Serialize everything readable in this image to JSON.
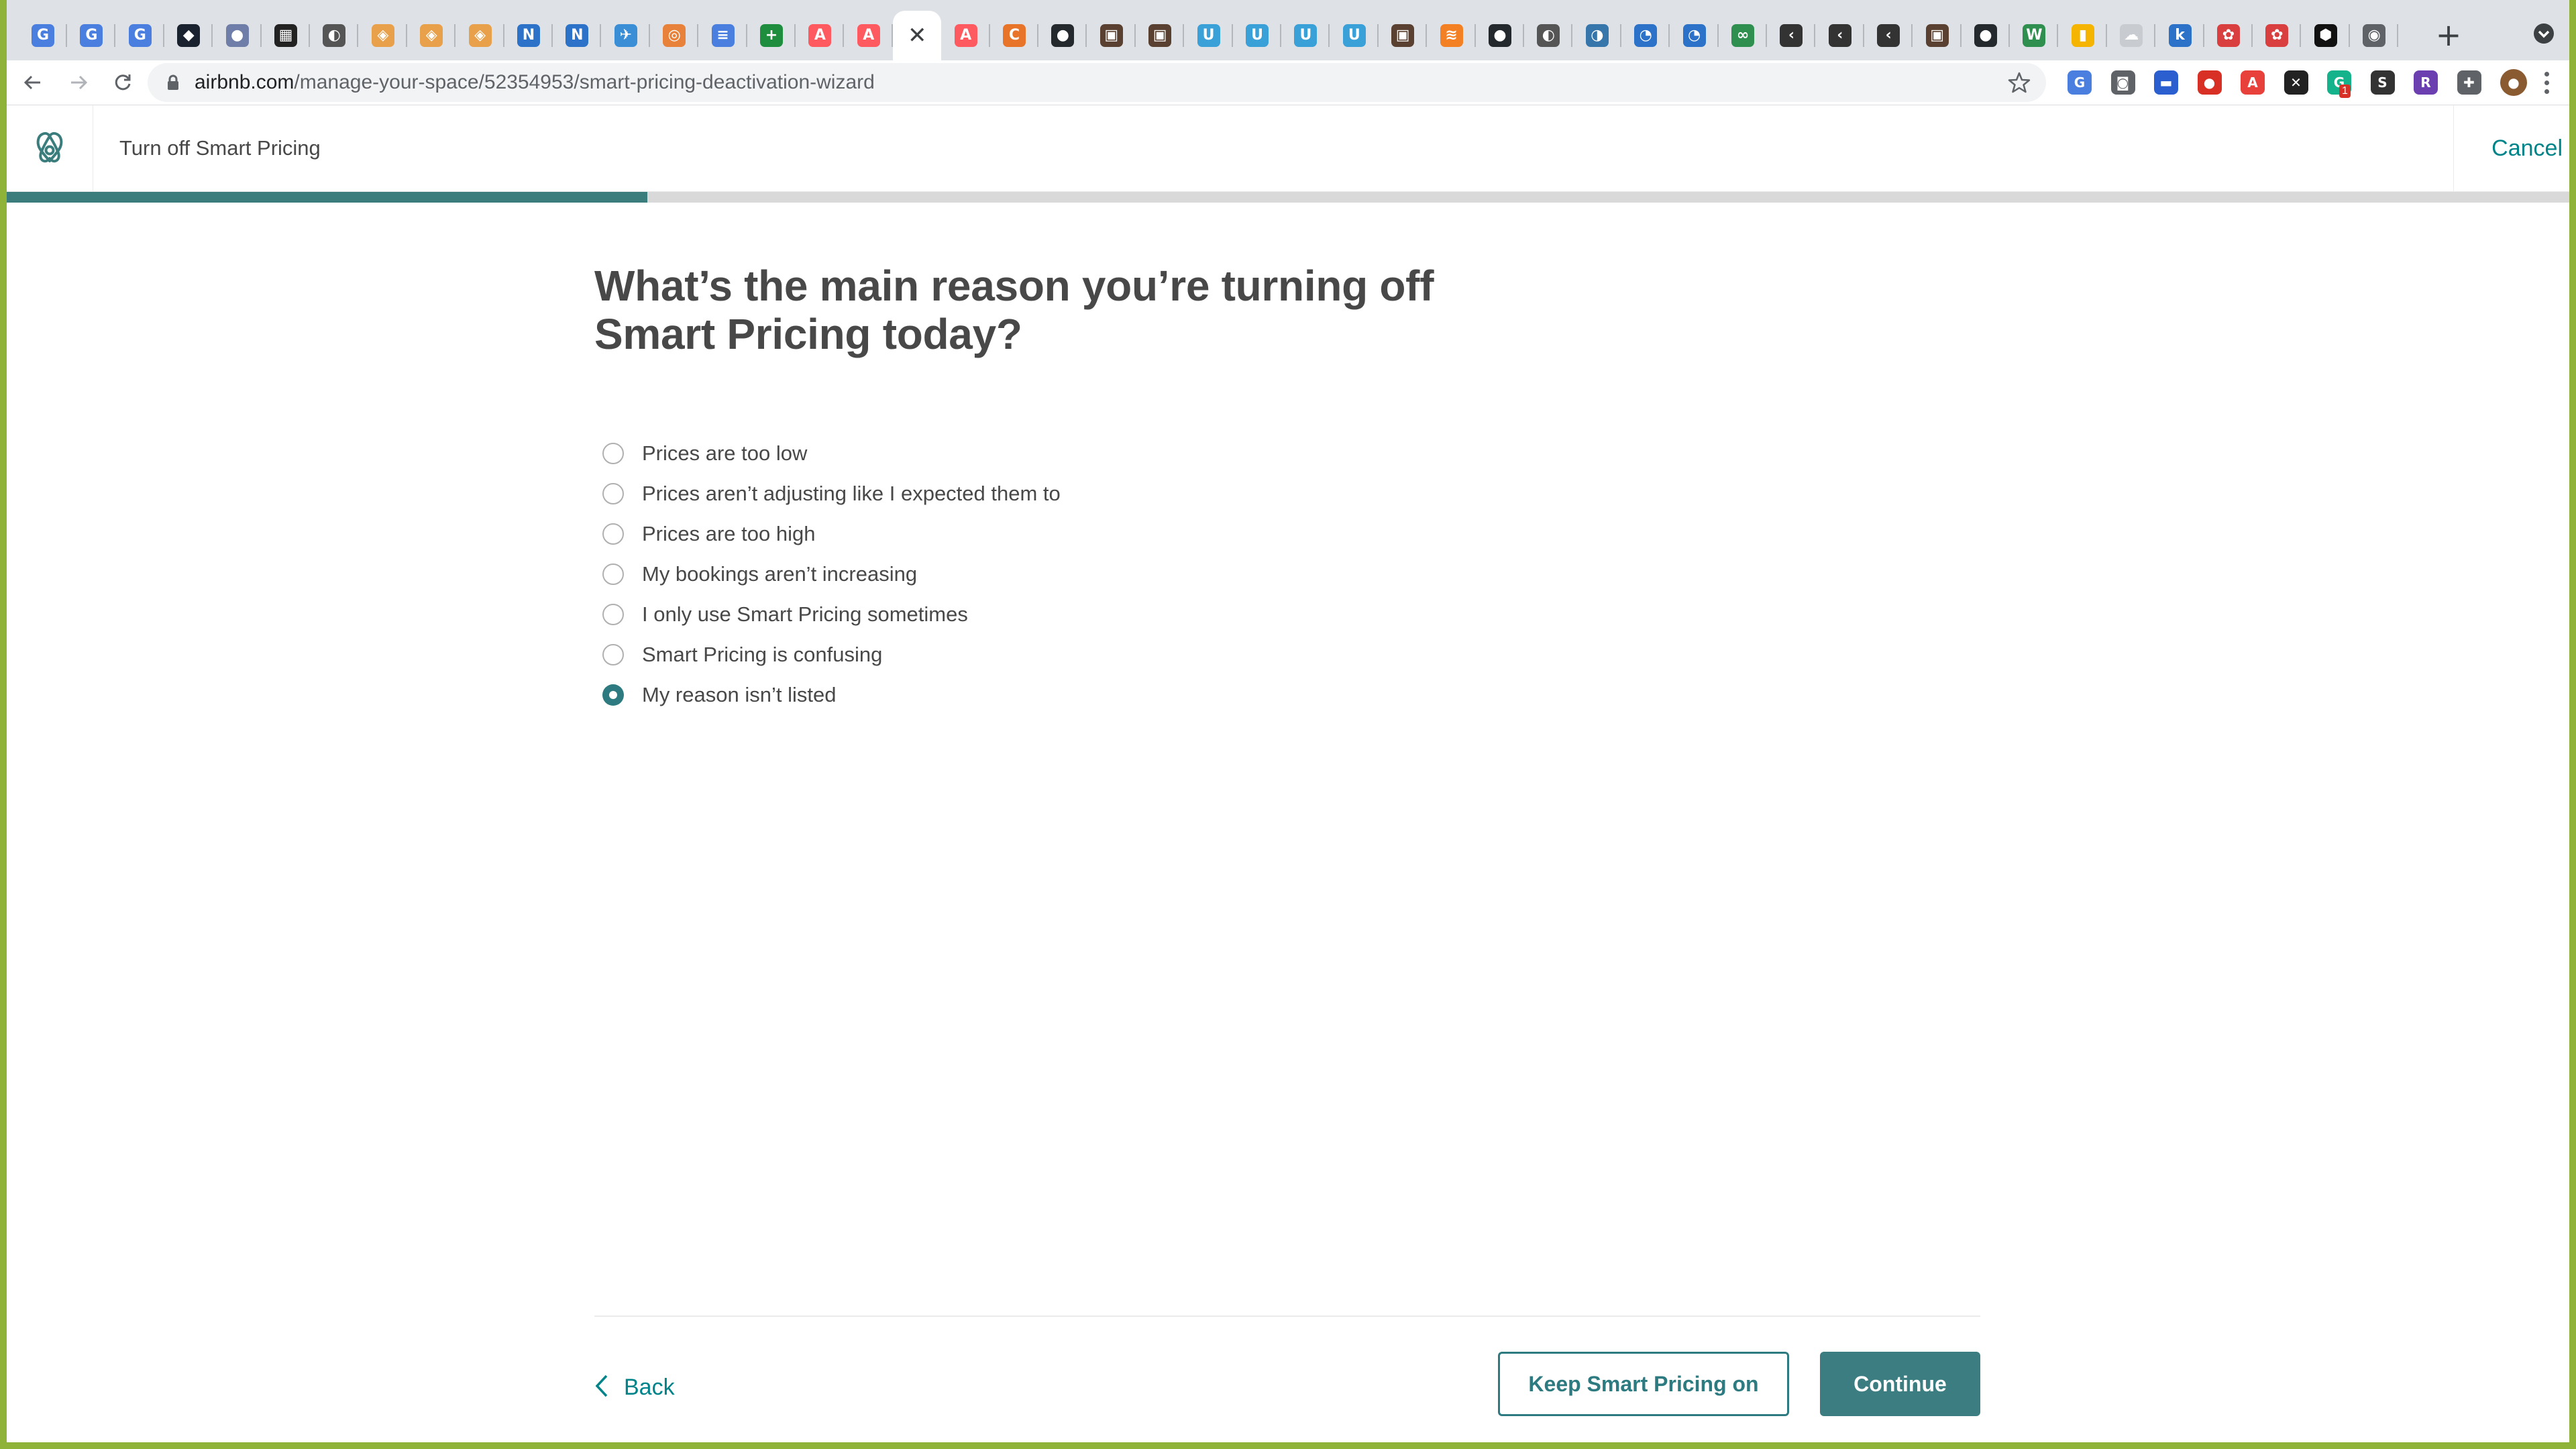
{
  "browser": {
    "tabs": [
      {
        "icon": "google-translate-icon",
        "glyph": "G",
        "color": "#4a7fe0"
      },
      {
        "icon": "google-translate-icon",
        "glyph": "G",
        "color": "#4a7fe0"
      },
      {
        "icon": "google-translate-icon",
        "glyph": "G",
        "color": "#4a7fe0"
      },
      {
        "icon": "hexagon-icon",
        "glyph": "◆",
        "color": "#1a2230"
      },
      {
        "icon": "circle-icon",
        "glyph": "●",
        "color": "#6f7ea8"
      },
      {
        "icon": "chart-icon",
        "glyph": "▦",
        "color": "#222222"
      },
      {
        "icon": "globe-icon",
        "glyph": "◐",
        "color": "#555555"
      },
      {
        "icon": "shield-icon",
        "glyph": "◈",
        "color": "#e8a04a"
      },
      {
        "icon": "shield-icon",
        "glyph": "◈",
        "color": "#e8a04a"
      },
      {
        "icon": "shield-icon",
        "glyph": "◈",
        "color": "#e8a04a"
      },
      {
        "icon": "n-logo-icon",
        "glyph": "N",
        "color": "#2b72c8"
      },
      {
        "icon": "n-logo-icon",
        "glyph": "N",
        "color": "#2b72c8"
      },
      {
        "icon": "bird-icon",
        "glyph": "✈",
        "color": "#3a8ed6"
      },
      {
        "icon": "magnifier-icon",
        "glyph": "◎",
        "color": "#e8823a"
      },
      {
        "icon": "google-docs-icon",
        "glyph": "≡",
        "color": "#4a7fe0"
      },
      {
        "icon": "google-sheets-plus-icon",
        "glyph": "+",
        "color": "#1e8e3e"
      },
      {
        "icon": "airbnb-icon",
        "glyph": "A",
        "color": "#ff5a5f"
      },
      {
        "icon": "airbnb-icon",
        "glyph": "A",
        "color": "#ff5a5f"
      },
      {
        "icon": "close-icon",
        "glyph": "✕",
        "color": "#3c4043",
        "active": true
      },
      {
        "icon": "airbnb-icon",
        "glyph": "A",
        "color": "#ff5a5f"
      },
      {
        "icon": "bracket-icon",
        "glyph": "C",
        "color": "#e8742a"
      },
      {
        "icon": "github-icon",
        "glyph": "●",
        "color": "#24292e"
      },
      {
        "icon": "book-icon",
        "glyph": "▣",
        "color": "#5a4030"
      },
      {
        "icon": "book-icon",
        "glyph": "▣",
        "color": "#5a4030"
      },
      {
        "icon": "u-logo-icon",
        "glyph": "U",
        "color": "#3aa0d8"
      },
      {
        "icon": "u-logo-icon",
        "glyph": "U",
        "color": "#3aa0d8"
      },
      {
        "icon": "u-logo-icon",
        "glyph": "U",
        "color": "#3aa0d8"
      },
      {
        "icon": "u-logo-icon",
        "glyph": "U",
        "color": "#3aa0d8"
      },
      {
        "icon": "book-icon",
        "glyph": "▣",
        "color": "#5a4030"
      },
      {
        "icon": "stack-icon",
        "glyph": "≋",
        "color": "#f48024"
      },
      {
        "icon": "github-icon",
        "glyph": "●",
        "color": "#24292e"
      },
      {
        "icon": "globe-icon",
        "glyph": "◐",
        "color": "#555555"
      },
      {
        "icon": "python-icon",
        "glyph": "◑",
        "color": "#3776ab"
      },
      {
        "icon": "swirl-icon",
        "glyph": "◔",
        "color": "#2b72c8"
      },
      {
        "icon": "swirl-icon",
        "glyph": "◔",
        "color": "#2b72c8"
      },
      {
        "icon": "glasses-icon",
        "glyph": "∞",
        "color": "#2f8f4f"
      },
      {
        "icon": "feather-icon",
        "glyph": "‹",
        "color": "#333333"
      },
      {
        "icon": "feather-icon",
        "glyph": "‹",
        "color": "#333333"
      },
      {
        "icon": "feather-icon",
        "glyph": "‹",
        "color": "#333333"
      },
      {
        "icon": "book-icon",
        "glyph": "▣",
        "color": "#5a4030"
      },
      {
        "icon": "github-icon",
        "glyph": "●",
        "color": "#24292e"
      },
      {
        "icon": "w-logo-icon",
        "glyph": "W",
        "color": "#2f8f4f"
      },
      {
        "icon": "bar-chart-icon",
        "glyph": "▮",
        "color": "#f4b400"
      },
      {
        "icon": "cloud-icon",
        "glyph": "☁",
        "color": "#c8ccd0"
      },
      {
        "icon": "k-logo-icon",
        "glyph": "k",
        "color": "#2b72c8"
      },
      {
        "icon": "flower-icon",
        "glyph": "✿",
        "color": "#d93f3f"
      },
      {
        "icon": "flower-icon",
        "glyph": "✿",
        "color": "#d93f3f"
      },
      {
        "icon": "hexagon-icon",
        "glyph": "⬢",
        "color": "#111111"
      },
      {
        "icon": "chrome-icon",
        "glyph": "◉",
        "color": "#5f6368"
      }
    ],
    "address_host": "airbnb.com",
    "address_path": "/manage-your-space/52354953/smart-pricing-deactivation-wizard",
    "extensions": [
      {
        "icon": "translate-extension-icon",
        "glyph": "G",
        "color": "#4a7fe0"
      },
      {
        "icon": "screenshot-extension-icon",
        "glyph": "◙",
        "color": "#5f6368"
      },
      {
        "icon": "calendar-extension-icon",
        "glyph": "▬",
        "color": "#2b5fd0"
      },
      {
        "icon": "record-extension-icon",
        "glyph": "●",
        "color": "#d93025"
      },
      {
        "icon": "adblock-extension-icon",
        "glyph": "A",
        "color": "#e8403a"
      },
      {
        "icon": "x-extension-icon",
        "glyph": "✕",
        "color": "#222222"
      },
      {
        "icon": "grammarly-extension-icon",
        "glyph": "G",
        "color": "#15b38b",
        "badge": "1"
      },
      {
        "icon": "sb-extension-icon",
        "glyph": "S",
        "color": "#333333"
      },
      {
        "icon": "r-extension-icon",
        "glyph": "R",
        "color": "#6b3fb0"
      },
      {
        "icon": "puzzle-extensions-icon",
        "glyph": "✚",
        "color": "#5f6368"
      },
      {
        "icon": "profile-avatar-icon",
        "glyph": "●",
        "color": "#8a5a30"
      }
    ]
  },
  "header": {
    "title": "Turn off Smart Pricing",
    "cancel_label": "Cancel"
  },
  "wizard": {
    "progress_percent": 25
  },
  "question": "What’s the main reason you’re turning off Smart Pricing today?",
  "options": [
    {
      "label": "Prices are too low",
      "selected": false
    },
    {
      "label": "Prices aren’t adjusting like I expected them to",
      "selected": false
    },
    {
      "label": "Prices are too high",
      "selected": false
    },
    {
      "label": "My bookings aren’t increasing",
      "selected": false
    },
    {
      "label": "I only use Smart Pricing sometimes",
      "selected": false
    },
    {
      "label": "Smart Pricing is confusing",
      "selected": false
    },
    {
      "label": "My reason isn’t listed",
      "selected": true
    }
  ],
  "footer": {
    "back_label": "Back",
    "keep_label": "Keep Smart Pricing on",
    "continue_label": "Continue"
  },
  "colors": {
    "accent": "#2d7b80",
    "link": "#008489",
    "progress": "#3b7d7d"
  }
}
